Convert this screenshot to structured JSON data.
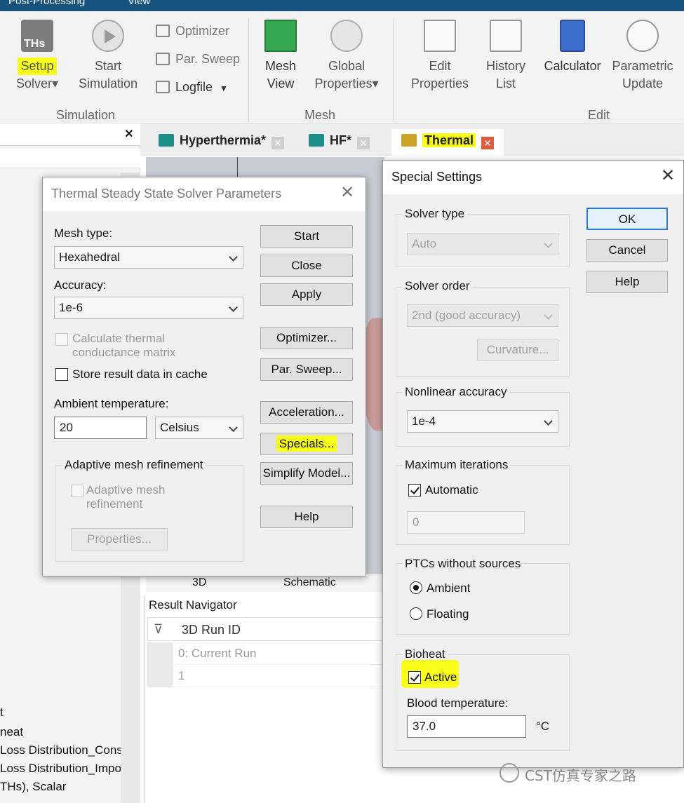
{
  "menubar": {
    "items": [
      "Post-Processing",
      "View"
    ]
  },
  "ribbon": {
    "setup_solver": {
      "line1": "Setup",
      "line2": "Solver▾"
    },
    "start_simulation": {
      "line1": "Start",
      "line2": "Simulation"
    },
    "optimizer": "Optimizer",
    "par_sweep": "Par. Sweep",
    "logfile": "Logfile",
    "mesh_view": {
      "line1": "Mesh",
      "line2": "View"
    },
    "global_properties": {
      "line1": "Global",
      "line2": "Properties▾"
    },
    "edit_properties": {
      "line1": "Edit",
      "line2": "Properties"
    },
    "history_list": {
      "line1": "History",
      "line2": "List"
    },
    "calculator": "Calculator",
    "parametric_update": {
      "line1": "Parametric",
      "line2": "Update"
    },
    "groups": [
      "Simulation",
      "Mesh",
      "Edit"
    ],
    "icon_text": "THs"
  },
  "tabs": [
    {
      "label": "Hyperthermia*",
      "icon": "hyperthermia-tab-icon"
    },
    {
      "label": "HF*",
      "icon": "hf-tab-icon"
    },
    {
      "label": "Thermal",
      "icon": "thermal-tab-icon"
    }
  ],
  "left_panel": {
    "close": "×",
    "tree_rows": [
      "t",
      "neat",
      "Loss Distribution_Consi",
      "Loss Distribution_Impor",
      "THs), Scalar"
    ]
  },
  "view_tabs": [
    "3D",
    "Schematic"
  ],
  "result_navigator": {
    "title": "Result Navigator",
    "header": "3D Run ID",
    "rows": [
      "0: Current Run",
      "1"
    ]
  },
  "solver_dialog": {
    "title": "Thermal Steady State Solver Parameters",
    "mesh_type_label": "Mesh type:",
    "mesh_type_value": "Hexahedral",
    "accuracy_label": "Accuracy:",
    "accuracy_value": "1e-6",
    "calc_conductance_line1": "Calculate thermal",
    "calc_conductance_line2": "conductance matrix",
    "store_cache_label": "Store result data in cache",
    "ambient_label": "Ambient temperature:",
    "ambient_value": "20",
    "ambient_unit": "Celsius",
    "adaptive_group": "Adaptive mesh refinement",
    "adaptive_check_line1": "Adaptive mesh",
    "adaptive_check_line2": "refinement",
    "properties_btn": "Properties...",
    "buttons": {
      "start": "Start",
      "close": "Close",
      "apply": "Apply",
      "optimizer": "Optimizer...",
      "par_sweep": "Par. Sweep...",
      "acceleration": "Acceleration...",
      "specials": "Specials...",
      "simplify": "Simplify Model...",
      "help": "Help"
    }
  },
  "special_dialog": {
    "title": "Special Settings",
    "solver_type_group": "Solver type",
    "solver_type_value": "Auto",
    "solver_order_group": "Solver order",
    "solver_order_value": "2nd (good accuracy)",
    "curvature_btn": "Curvature...",
    "nonlinear_group": "Nonlinear accuracy",
    "nonlinear_value": "1e-4",
    "max_iter_group": "Maximum iterations",
    "automatic_label": "Automatic",
    "max_iter_value": "0",
    "ptc_group": "PTCs without sources",
    "ambient_radio": "Ambient",
    "floating_radio": "Floating",
    "bioheat_group": "Bioheat",
    "active_label": "Active",
    "blood_temp_label": "Blood temperature:",
    "blood_temp_value": "37.0",
    "blood_temp_unit": "°C",
    "ok": "OK",
    "cancel": "Cancel",
    "help": "Help"
  },
  "watermark": "CST仿真专家之路",
  "colors": {
    "highlight": "#f7ff1a",
    "menubar": "#17527d",
    "default_button_border": "#2c78d4"
  }
}
